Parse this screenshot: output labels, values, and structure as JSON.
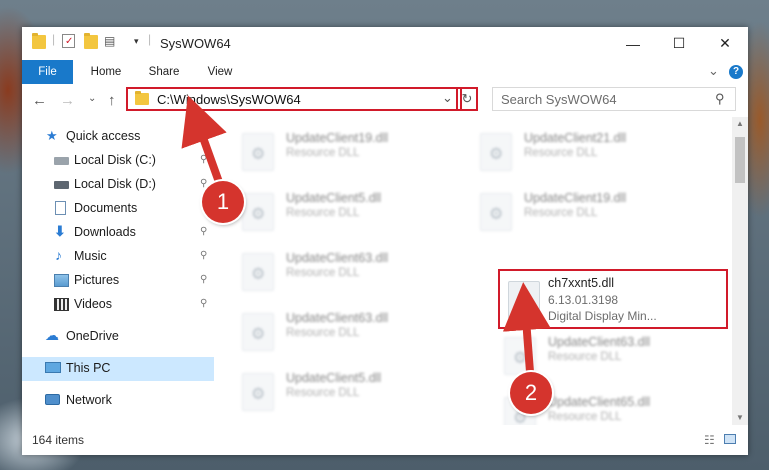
{
  "window": {
    "title": "SysWOW64",
    "minimize_glyph": "—",
    "maximize_glyph": "☐",
    "close_glyph": "✕"
  },
  "ribbon": {
    "tabs": [
      "File",
      "Home",
      "Share",
      "View"
    ],
    "expand_glyph": "⌄",
    "help_glyph": "?"
  },
  "address": {
    "path": "C:\\Windows\\SysWOW64",
    "dropdown_glyph": "⌄",
    "refresh_glyph": "↻",
    "search_placeholder": "Search SysWOW64",
    "search_glyph": "⚲"
  },
  "nav": {
    "back_glyph": "←",
    "forward_glyph": "→",
    "recent_glyph": "⌄",
    "up_glyph": "↑",
    "items": [
      {
        "label": "Quick access",
        "icon": "star-icon",
        "pinned": false
      },
      {
        "label": "Local Disk (C:)",
        "icon": "drive-icon",
        "pinned": true
      },
      {
        "label": "Local Disk (D:)",
        "icon": "drive-icon",
        "pinned": true
      },
      {
        "label": "Documents",
        "icon": "documents-icon",
        "pinned": true
      },
      {
        "label": "Downloads",
        "icon": "download-icon",
        "pinned": true
      },
      {
        "label": "Music",
        "icon": "music-icon",
        "pinned": true
      },
      {
        "label": "Pictures",
        "icon": "pictures-icon",
        "pinned": true
      },
      {
        "label": "Videos",
        "icon": "videos-icon",
        "pinned": true
      },
      {
        "label": "OneDrive",
        "icon": "cloud-icon",
        "pinned": false
      },
      {
        "label": "This PC",
        "icon": "computer-icon",
        "pinned": false
      },
      {
        "label": "Network",
        "icon": "network-icon",
        "pinned": false
      }
    ],
    "pin_glyph": "📌"
  },
  "files": [
    {
      "name": "UpdateClient19.dll",
      "desc": "Resource DLL"
    },
    {
      "name": "UpdateClient21.dll",
      "desc": "Resource DLL"
    },
    {
      "name": "UpdateClient5.dll",
      "desc": "Resource DLL"
    },
    {
      "name": "UpdateClient19.dll",
      "desc": "Resource DLL"
    },
    {
      "name": "UpdateClient63.dll",
      "desc": "Resource DLL"
    },
    {
      "name": "ch7xxnt5.dll",
      "desc": "6.13.01.3198",
      "desc2": "Digital Display Min..."
    },
    {
      "name": "UpdateClient63.dll",
      "desc": "Resource DLL"
    },
    {
      "name": "UpdateClient63.dll",
      "desc": "Resource DLL"
    },
    {
      "name": "UpdateClient5.dll",
      "desc": "Resource DLL"
    },
    {
      "name": "UpdateClient65.dll",
      "desc": "Resource DLL"
    }
  ],
  "status": {
    "item_count": "164 items"
  },
  "annotations": {
    "step1": "1",
    "step2": "2",
    "color": "#d5342d"
  },
  "colors": {
    "accent": "#1979ca",
    "highlight_border": "#d11a2a",
    "selected_bg": "#cce8ff"
  }
}
